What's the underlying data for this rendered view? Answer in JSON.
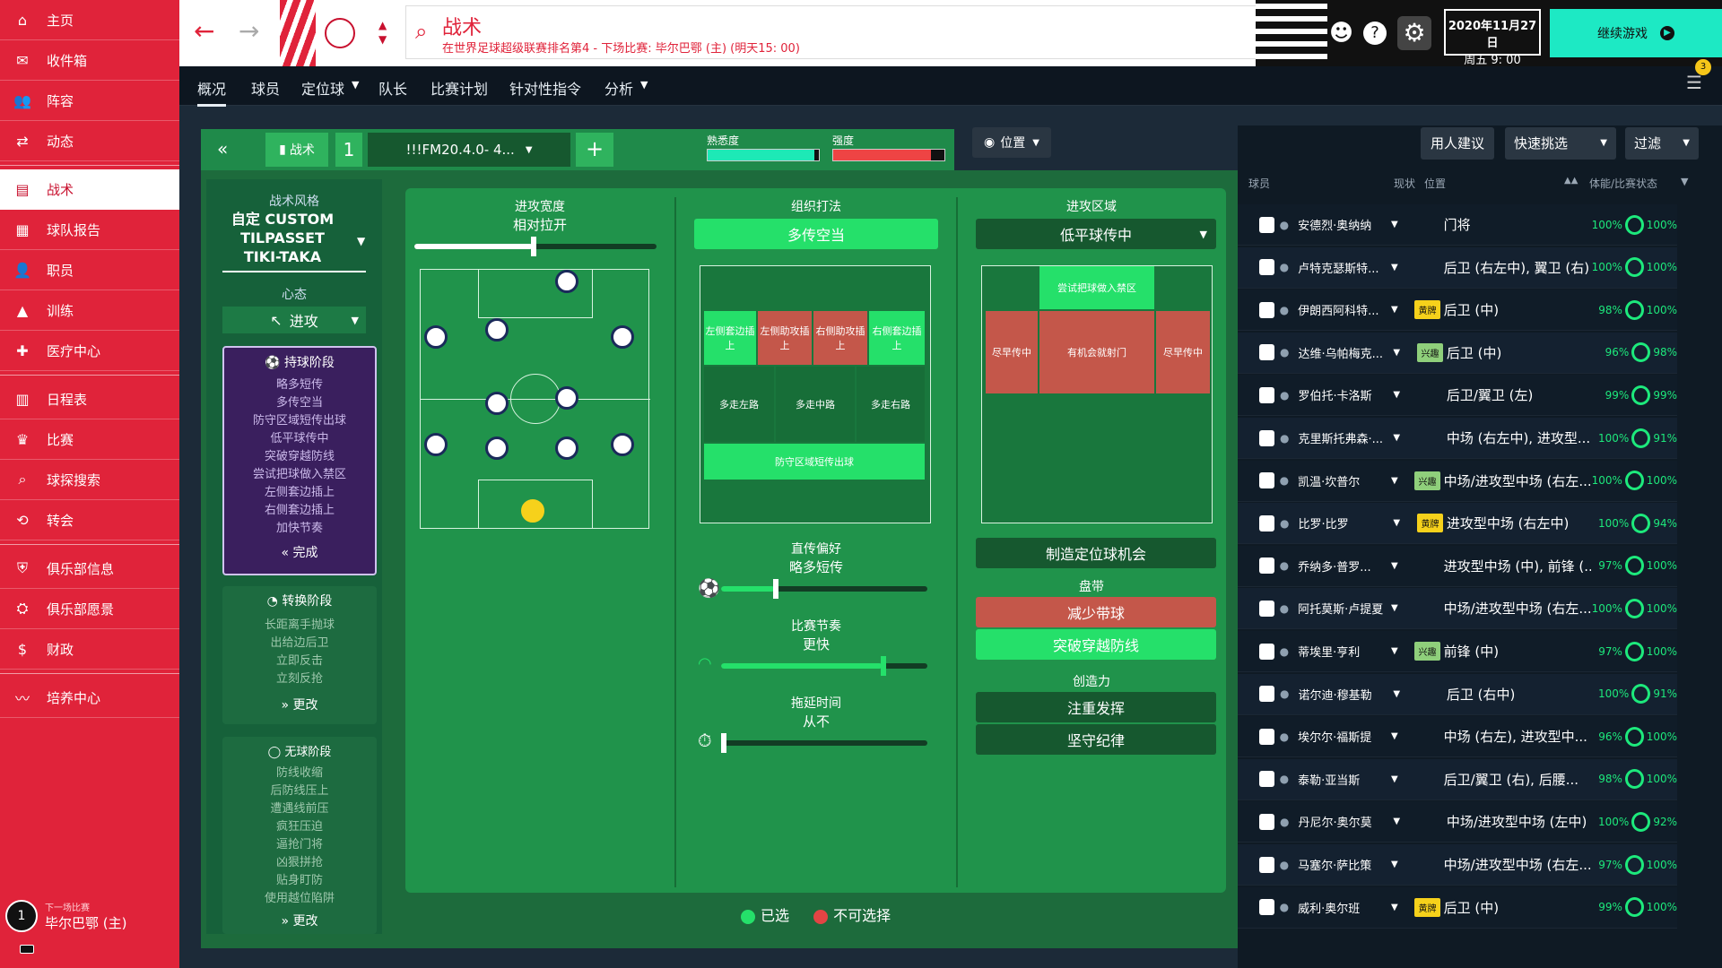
{
  "sidebar": {
    "items": [
      {
        "label": "主页",
        "icon": "home-icon",
        "glyph": "⌂"
      },
      {
        "label": "收件箱",
        "icon": "inbox-icon",
        "glyph": "✉"
      },
      {
        "label": "阵容",
        "icon": "squad-icon",
        "glyph": "👥"
      },
      {
        "label": "动态",
        "icon": "dynamics-icon",
        "glyph": "⇄"
      },
      {
        "label": "战术",
        "icon": "tactics-icon",
        "glyph": "▤"
      },
      {
        "label": "球队报告",
        "icon": "report-icon",
        "glyph": "▦"
      },
      {
        "label": "职员",
        "icon": "staff-icon",
        "glyph": "👤"
      },
      {
        "label": "训练",
        "icon": "training-icon",
        "glyph": "▲"
      },
      {
        "label": "医疗中心",
        "icon": "medical-icon",
        "glyph": "✚"
      },
      {
        "label": "日程表",
        "icon": "schedule-icon",
        "glyph": "▥"
      },
      {
        "label": "比赛",
        "icon": "trophy-icon",
        "glyph": "♛"
      },
      {
        "label": "球探搜索",
        "icon": "search-icon",
        "glyph": "⌕"
      },
      {
        "label": "转会",
        "icon": "transfer-icon",
        "glyph": "⟲"
      },
      {
        "label": "俱乐部信息",
        "icon": "shield-icon",
        "glyph": "⛨"
      },
      {
        "label": "俱乐部愿景",
        "icon": "vision-icon",
        "glyph": "⛭"
      },
      {
        "label": "财政",
        "icon": "finance-icon",
        "glyph": "$"
      },
      {
        "label": "培养中心",
        "icon": "development-icon",
        "glyph": "〰"
      }
    ],
    "active_index": 4,
    "next_match_caption": "下一场比赛",
    "next_match_team": "毕尔巴鄂 (主)",
    "next_match_badge": "1"
  },
  "topbar": {
    "title": "战术",
    "subtitle": "在世界足球超级联赛排名第4 - 下场比赛: 毕尔巴鄂 (主) (明天15: 00)",
    "date": "2020年11月27日",
    "day": "周五 9: 00",
    "continue": "继续游戏"
  },
  "subtabs": [
    "概况",
    "球员",
    "定位球",
    "队长",
    "比赛计划",
    "针对性指令",
    "分析"
  ],
  "notify_count": "3",
  "tactic": {
    "label": "战术",
    "slot": "1",
    "name": "!!!FM20.4.0- 4...",
    "familiarity_label": "熟悉度",
    "intensity_label": "强度",
    "style_caption": "战术风格",
    "style_name": "自定 CUSTOM TILPASSET TIKI-TAKA",
    "mentality_caption": "心态",
    "mentality": "进攻"
  },
  "phases": {
    "possession": {
      "title": "持球阶段",
      "items": [
        "略多短传",
        "多传空当",
        "防守区域短传出球",
        "低平球传中",
        "突破穿越防线",
        "尝试把球做入禁区",
        "左侧套边插上",
        "右侧套边插上",
        "加快节奏"
      ],
      "action": "完成"
    },
    "transition": {
      "title": "转换阶段",
      "items": [
        "长距离手抛球",
        "出给边后卫",
        "立即反击",
        "立刻反抢"
      ],
      "action": "更改"
    },
    "defence": {
      "title": "无球阶段",
      "items": [
        "防线收缩",
        "后防线压上",
        "遭遇线前压",
        "疯狂压迫",
        "逼抢门将",
        "凶狠拼抢",
        "贴身盯防",
        "使用越位陷阱"
      ],
      "action": "更改"
    }
  },
  "columns": {
    "width": {
      "title": "进攻宽度",
      "value": "相对拉开"
    },
    "buildup": {
      "title": "组织打法",
      "value": "多传空当",
      "zones": [
        "左侧套边插上",
        "左侧助攻插上",
        "右侧助攻插上",
        "右侧套边插上",
        "多走左路",
        "多走中路",
        "多走右路",
        "防守区域短传出球"
      ],
      "pass_caption": "直传偏好",
      "pass_value": "略多短传",
      "tempo_caption": "比赛节奏",
      "tempo_value": "更快",
      "time_caption": "拖延时间",
      "time_value": "从不"
    },
    "final": {
      "title": "进攻区域",
      "value": "低平球传中",
      "zones": [
        "尝试把球做入禁区",
        "尽早传中",
        "有机会就射门",
        "尽早传中"
      ],
      "set_piece": "制造定位球机会",
      "dribble_caption": "盘带",
      "dribble_a": "减少带球",
      "dribble_b": "突破穿越防线",
      "creative_caption": "创造力",
      "creative_a": "注重发挥",
      "creative_b": "坚守纪律"
    }
  },
  "legend": {
    "selected": "已选",
    "unavailable": "不可选择"
  },
  "right": {
    "position_btn": "位置",
    "suggest_btn": "用人建议",
    "quick_btn": "快速挑选",
    "filter_btn": "过滤",
    "hdr_player": "球员",
    "hdr_status": "现状",
    "hdr_pos": "位置",
    "hdr_cond": "体能/比赛状态"
  },
  "players": [
    {
      "name": "安德烈·奥纳纳",
      "badge": "",
      "pos": "门将",
      "cond": "100%",
      "sharp": "100%"
    },
    {
      "name": "卢特克瑟斯特...",
      "badge": "",
      "pos": "后卫 (右左中), 翼卫 (右)",
      "cond": "100%",
      "sharp": "100%"
    },
    {
      "name": "伊朗西阿科特...",
      "badge": "黄牌",
      "pos": "后卫 (中)",
      "cond": "98%",
      "sharp": "100%"
    },
    {
      "name": "达维·乌帕梅克...",
      "badge": "兴趣",
      "pos": "后卫 (中)",
      "cond": "96%",
      "sharp": "98%"
    },
    {
      "name": "罗伯托·卡洛斯",
      "badge": "",
      "pos": "后卫/翼卫 (左)",
      "cond": "99%",
      "sharp": "99%"
    },
    {
      "name": "克里斯托弗森·...",
      "badge": "",
      "pos": "中场 (右左中), 进攻型...",
      "cond": "100%",
      "sharp": "91%"
    },
    {
      "name": "凯温·坎普尔",
      "badge": "兴趣",
      "pos": "中场/进攻型中场 (右左...",
      "cond": "100%",
      "sharp": "100%"
    },
    {
      "name": "比罗·比罗",
      "badge": "黄牌",
      "pos": "进攻型中场 (右左中)",
      "cond": "100%",
      "sharp": "94%"
    },
    {
      "name": "乔纳多·普罗...",
      "badge": "",
      "pos": "进攻型中场 (中), 前锋 (...",
      "cond": "97%",
      "sharp": "100%"
    },
    {
      "name": "阿托莫斯·卢提夏",
      "badge": "",
      "pos": "中场/进攻型中场 (右左...",
      "cond": "100%",
      "sharp": "100%"
    },
    {
      "name": "蒂埃里·亨利",
      "badge": "兴趣",
      "pos": "前锋 (中)",
      "cond": "97%",
      "sharp": "100%"
    },
    {
      "name": "诺尔迪·穆基勒",
      "badge": "",
      "pos": "后卫 (右中)",
      "cond": "100%",
      "sharp": "91%"
    },
    {
      "name": "埃尔尔·福斯提",
      "badge": "",
      "pos": "中场 (右左), 进攻型中...",
      "cond": "96%",
      "sharp": "100%"
    },
    {
      "name": "泰勒·亚当斯",
      "badge": "",
      "pos": "后卫/翼卫 (右), 后腰...",
      "cond": "98%",
      "sharp": "100%"
    },
    {
      "name": "丹尼尔·奥尔莫",
      "badge": "",
      "pos": "中场/进攻型中场 (左中)",
      "cond": "100%",
      "sharp": "92%"
    },
    {
      "name": "马塞尔·萨比策",
      "badge": "",
      "pos": "中场/进攻型中场 (右左...",
      "cond": "97%",
      "sharp": "100%"
    },
    {
      "name": "威利·奥尔班",
      "badge": "黄牌",
      "pos": "后卫 (中)",
      "cond": "99%",
      "sharp": "100%"
    }
  ],
  "colors": {
    "brand": "#e0233a",
    "accent": "#25e06a",
    "unavailable": "#e24444"
  }
}
